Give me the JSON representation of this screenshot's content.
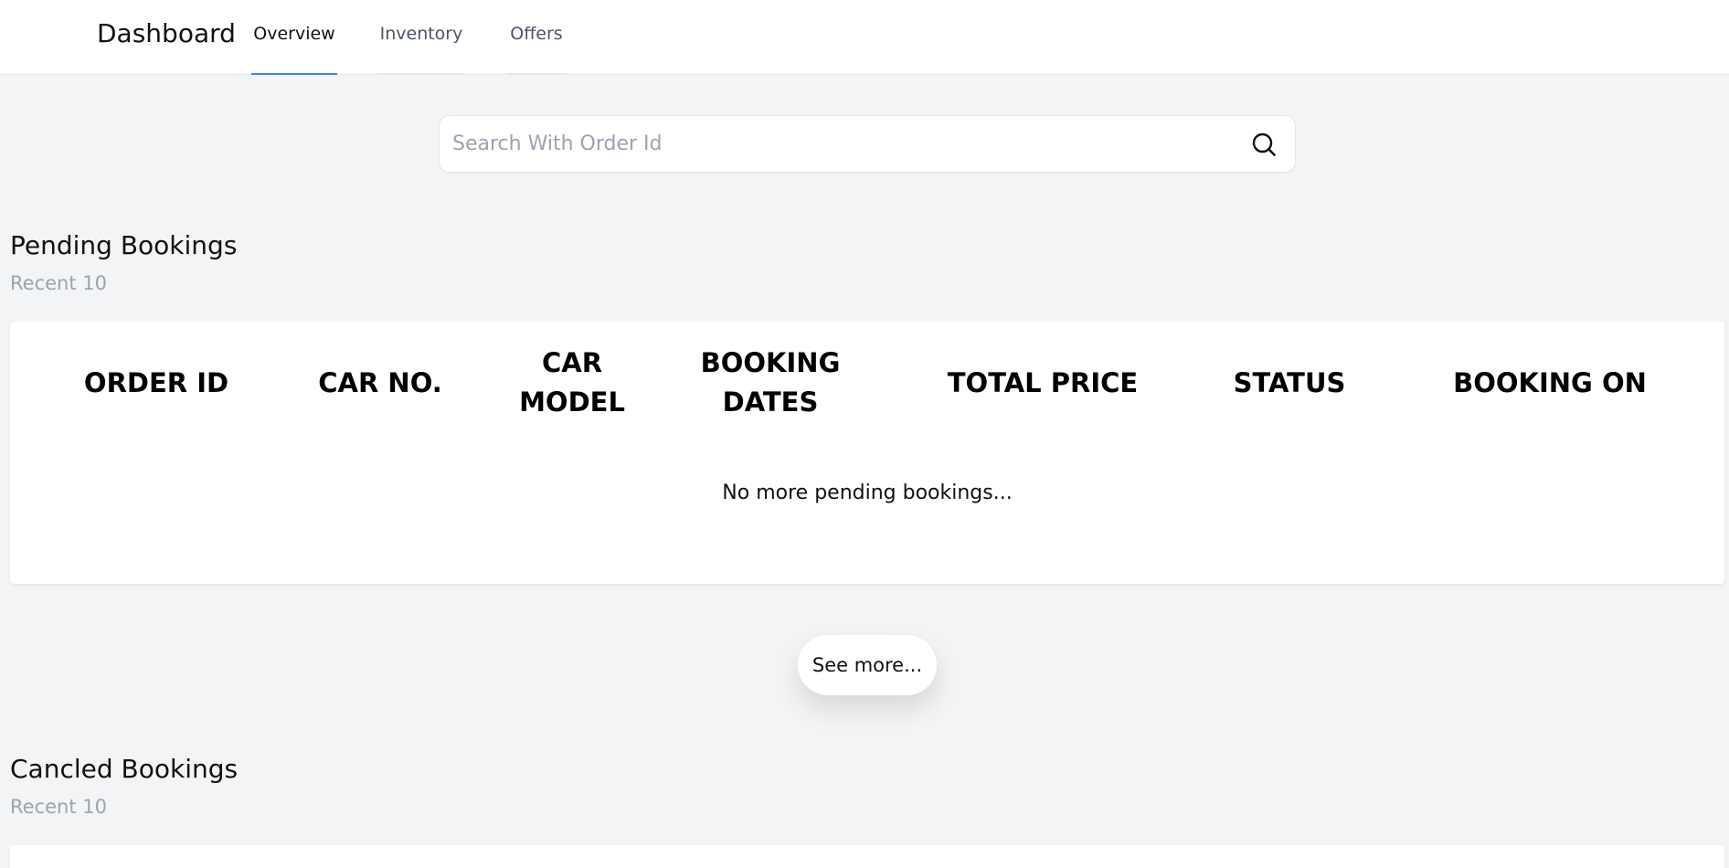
{
  "header": {
    "brand": "Dashboard",
    "tabs": [
      {
        "label": "Overview",
        "active": true
      },
      {
        "label": "Inventory",
        "active": false
      },
      {
        "label": "Offers",
        "active": false
      }
    ]
  },
  "search": {
    "placeholder": "Search With Order Id",
    "value": ""
  },
  "pending": {
    "title": "Pending Bookings",
    "subtitle": "Recent 10",
    "columns": [
      "ORDER ID",
      "CAR NO.",
      "CAR MODEL",
      "BOOKING DATES",
      "TOTAL PRICE",
      "STATUS",
      "BOOKING ON"
    ],
    "empty_message": "No more pending bookings...",
    "see_more_label": "See more..."
  },
  "canceled": {
    "title": "Cancled Bookings",
    "subtitle": "Recent 10"
  },
  "colors": {
    "accent": "#3b82f6",
    "background": "#f3f4f6",
    "muted_text": "#9ca3af"
  }
}
